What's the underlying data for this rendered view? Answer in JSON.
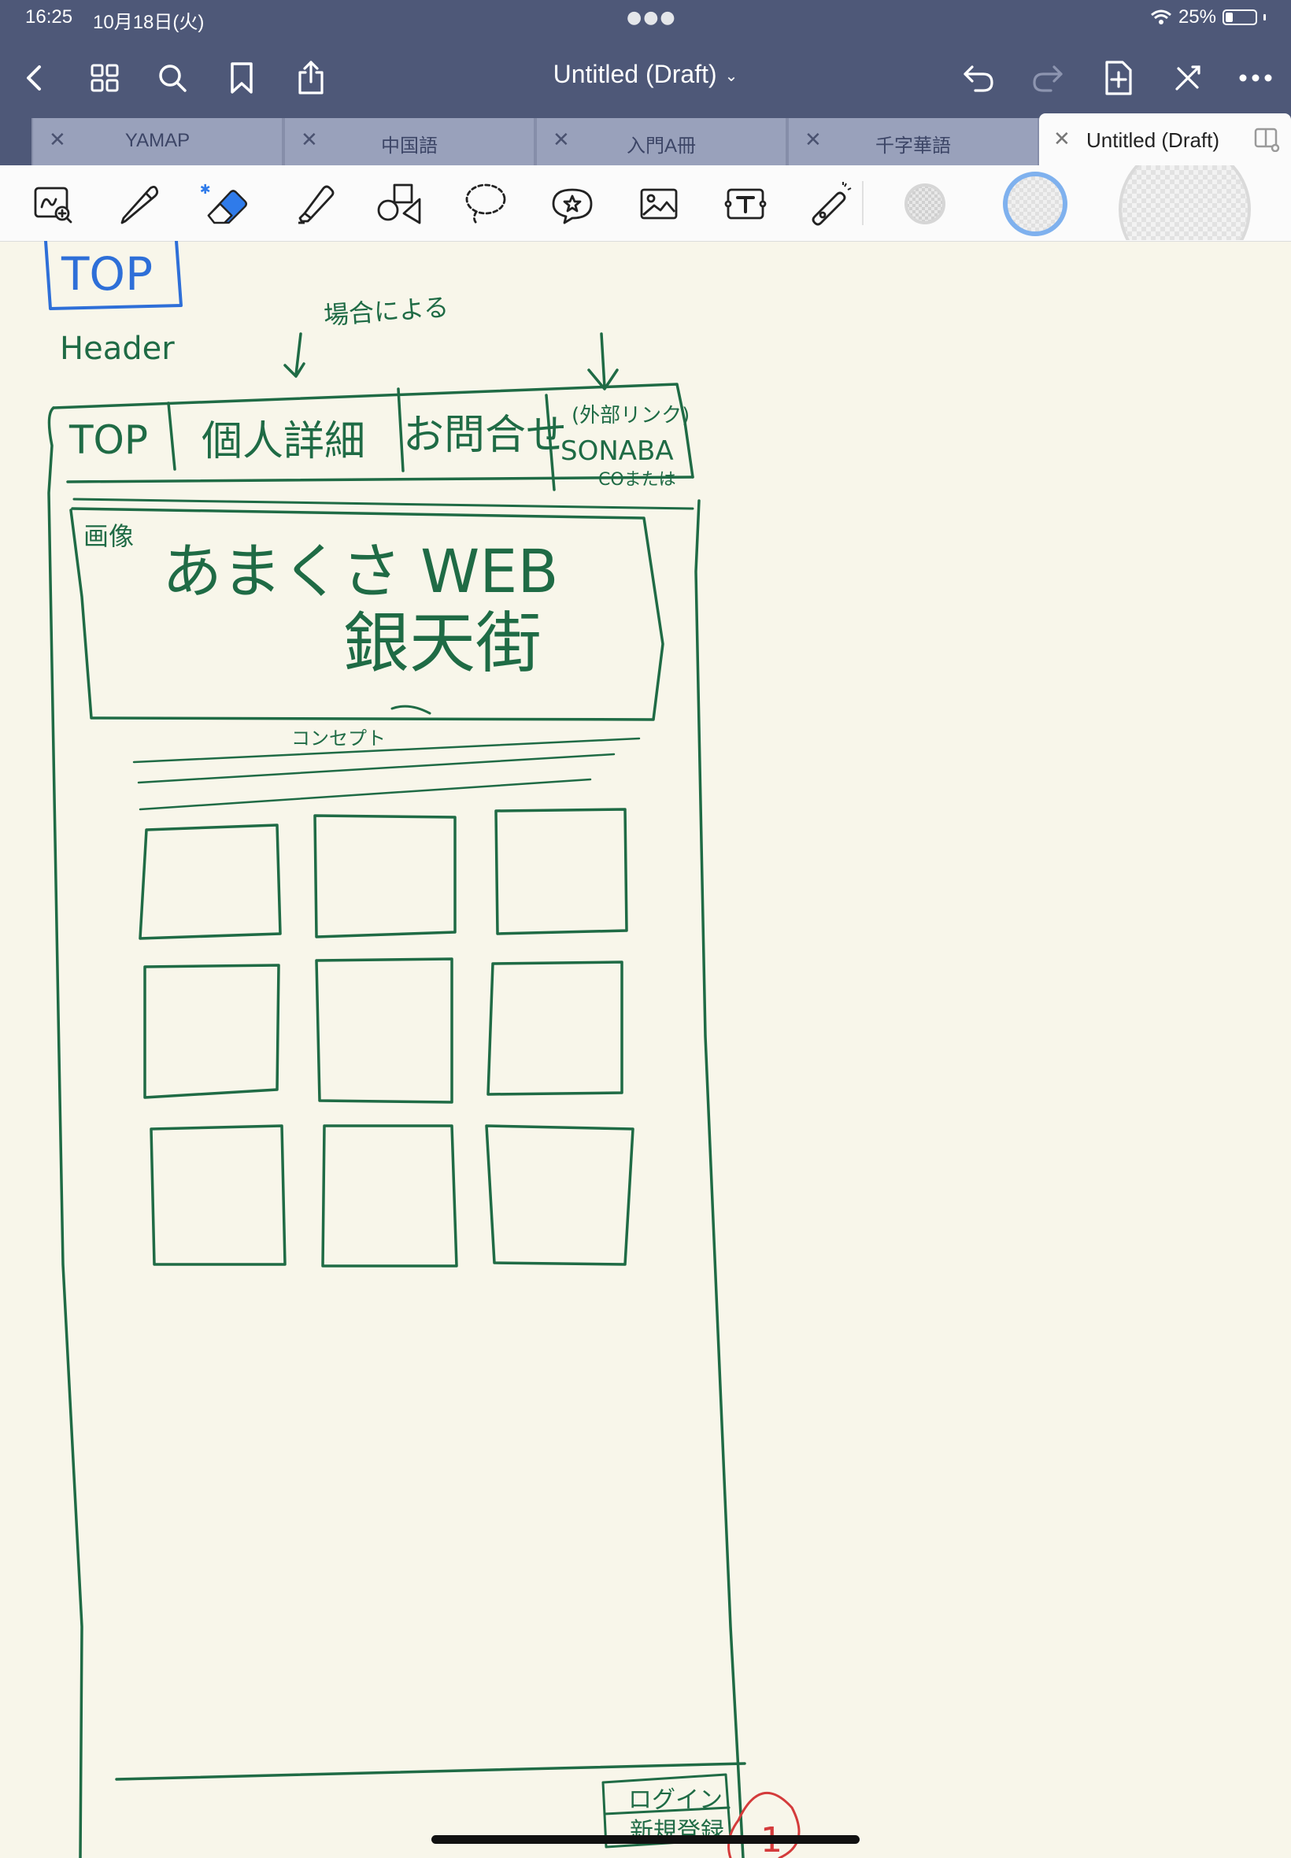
{
  "status_bar": {
    "time": "16:25",
    "date": "10月18日(火)",
    "battery": "25%",
    "battery_level": 0.25
  },
  "top_bar": {
    "title": "Untitled (Draft)",
    "buttons": [
      "back-icon",
      "grid-icon",
      "search-icon",
      "bookmark-icon",
      "share-icon",
      "undo-icon",
      "redo-icon",
      "add-page-icon",
      "close-toolbar-icon",
      "more-icon"
    ]
  },
  "tabs": [
    {
      "label": "YAMAP",
      "active": false
    },
    {
      "label": "中国語",
      "active": false
    },
    {
      "label": "入門A冊",
      "active": false
    },
    {
      "label": "千字華語",
      "active": false
    },
    {
      "label": "Untitled (Draft)",
      "active": true
    }
  ],
  "tools": [
    "zoom-window-icon",
    "pen-icon",
    "eraser-icon",
    "highlighter-icon",
    "shapes-icon",
    "lasso-icon",
    "sticker-icon",
    "image-icon",
    "text-icon",
    "laser-pointer-icon"
  ],
  "colors": {
    "chrome": "#4e5878",
    "tab_inactive": "#99a1bb",
    "paper": "#f8f6ea",
    "ink_green": "#1f6b45",
    "ink_blue": "#2e6fd8",
    "ink_red": "#d43b3b",
    "eraser_blue": "#2f7bea",
    "selection_ring": "#7fb1ee"
  },
  "sketch": {
    "page_label": "TOP",
    "header_label": "Header",
    "note_conditional": "場合による",
    "nav_items": [
      "TOP",
      "個人詳細",
      "お問合せ"
    ],
    "nav_external": [
      "(外部リンク)",
      "SONABA",
      "COまたは"
    ],
    "hero_tag": "画像",
    "hero_title": "あまくさ WEB",
    "hero_subtitle": "銀天街",
    "concept_label": "コンセプト",
    "grid_rows": 3,
    "grid_cols": 3,
    "footer_login": "ログイン",
    "footer_register": "新規登録",
    "annotation_mark": "1"
  }
}
